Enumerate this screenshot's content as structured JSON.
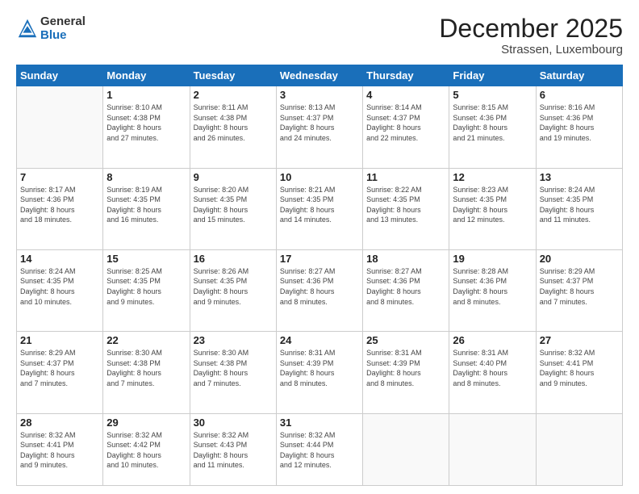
{
  "header": {
    "logo_general": "General",
    "logo_blue": "Blue",
    "month_title": "December 2025",
    "subtitle": "Strassen, Luxembourg"
  },
  "weekdays": [
    "Sunday",
    "Monday",
    "Tuesday",
    "Wednesday",
    "Thursday",
    "Friday",
    "Saturday"
  ],
  "weeks": [
    [
      {
        "day": "",
        "info": ""
      },
      {
        "day": "1",
        "info": "Sunrise: 8:10 AM\nSunset: 4:38 PM\nDaylight: 8 hours\nand 27 minutes."
      },
      {
        "day": "2",
        "info": "Sunrise: 8:11 AM\nSunset: 4:38 PM\nDaylight: 8 hours\nand 26 minutes."
      },
      {
        "day": "3",
        "info": "Sunrise: 8:13 AM\nSunset: 4:37 PM\nDaylight: 8 hours\nand 24 minutes."
      },
      {
        "day": "4",
        "info": "Sunrise: 8:14 AM\nSunset: 4:37 PM\nDaylight: 8 hours\nand 22 minutes."
      },
      {
        "day": "5",
        "info": "Sunrise: 8:15 AM\nSunset: 4:36 PM\nDaylight: 8 hours\nand 21 minutes."
      },
      {
        "day": "6",
        "info": "Sunrise: 8:16 AM\nSunset: 4:36 PM\nDaylight: 8 hours\nand 19 minutes."
      }
    ],
    [
      {
        "day": "7",
        "info": "Sunrise: 8:17 AM\nSunset: 4:36 PM\nDaylight: 8 hours\nand 18 minutes."
      },
      {
        "day": "8",
        "info": "Sunrise: 8:19 AM\nSunset: 4:35 PM\nDaylight: 8 hours\nand 16 minutes."
      },
      {
        "day": "9",
        "info": "Sunrise: 8:20 AM\nSunset: 4:35 PM\nDaylight: 8 hours\nand 15 minutes."
      },
      {
        "day": "10",
        "info": "Sunrise: 8:21 AM\nSunset: 4:35 PM\nDaylight: 8 hours\nand 14 minutes."
      },
      {
        "day": "11",
        "info": "Sunrise: 8:22 AM\nSunset: 4:35 PM\nDaylight: 8 hours\nand 13 minutes."
      },
      {
        "day": "12",
        "info": "Sunrise: 8:23 AM\nSunset: 4:35 PM\nDaylight: 8 hours\nand 12 minutes."
      },
      {
        "day": "13",
        "info": "Sunrise: 8:24 AM\nSunset: 4:35 PM\nDaylight: 8 hours\nand 11 minutes."
      }
    ],
    [
      {
        "day": "14",
        "info": "Sunrise: 8:24 AM\nSunset: 4:35 PM\nDaylight: 8 hours\nand 10 minutes."
      },
      {
        "day": "15",
        "info": "Sunrise: 8:25 AM\nSunset: 4:35 PM\nDaylight: 8 hours\nand 9 minutes."
      },
      {
        "day": "16",
        "info": "Sunrise: 8:26 AM\nSunset: 4:35 PM\nDaylight: 8 hours\nand 9 minutes."
      },
      {
        "day": "17",
        "info": "Sunrise: 8:27 AM\nSunset: 4:36 PM\nDaylight: 8 hours\nand 8 minutes."
      },
      {
        "day": "18",
        "info": "Sunrise: 8:27 AM\nSunset: 4:36 PM\nDaylight: 8 hours\nand 8 minutes."
      },
      {
        "day": "19",
        "info": "Sunrise: 8:28 AM\nSunset: 4:36 PM\nDaylight: 8 hours\nand 8 minutes."
      },
      {
        "day": "20",
        "info": "Sunrise: 8:29 AM\nSunset: 4:37 PM\nDaylight: 8 hours\nand 7 minutes."
      }
    ],
    [
      {
        "day": "21",
        "info": "Sunrise: 8:29 AM\nSunset: 4:37 PM\nDaylight: 8 hours\nand 7 minutes."
      },
      {
        "day": "22",
        "info": "Sunrise: 8:30 AM\nSunset: 4:38 PM\nDaylight: 8 hours\nand 7 minutes."
      },
      {
        "day": "23",
        "info": "Sunrise: 8:30 AM\nSunset: 4:38 PM\nDaylight: 8 hours\nand 7 minutes."
      },
      {
        "day": "24",
        "info": "Sunrise: 8:31 AM\nSunset: 4:39 PM\nDaylight: 8 hours\nand 8 minutes."
      },
      {
        "day": "25",
        "info": "Sunrise: 8:31 AM\nSunset: 4:39 PM\nDaylight: 8 hours\nand 8 minutes."
      },
      {
        "day": "26",
        "info": "Sunrise: 8:31 AM\nSunset: 4:40 PM\nDaylight: 8 hours\nand 8 minutes."
      },
      {
        "day": "27",
        "info": "Sunrise: 8:32 AM\nSunset: 4:41 PM\nDaylight: 8 hours\nand 9 minutes."
      }
    ],
    [
      {
        "day": "28",
        "info": "Sunrise: 8:32 AM\nSunset: 4:41 PM\nDaylight: 8 hours\nand 9 minutes."
      },
      {
        "day": "29",
        "info": "Sunrise: 8:32 AM\nSunset: 4:42 PM\nDaylight: 8 hours\nand 10 minutes."
      },
      {
        "day": "30",
        "info": "Sunrise: 8:32 AM\nSunset: 4:43 PM\nDaylight: 8 hours\nand 11 minutes."
      },
      {
        "day": "31",
        "info": "Sunrise: 8:32 AM\nSunset: 4:44 PM\nDaylight: 8 hours\nand 12 minutes."
      },
      {
        "day": "",
        "info": ""
      },
      {
        "day": "",
        "info": ""
      },
      {
        "day": "",
        "info": ""
      }
    ]
  ]
}
